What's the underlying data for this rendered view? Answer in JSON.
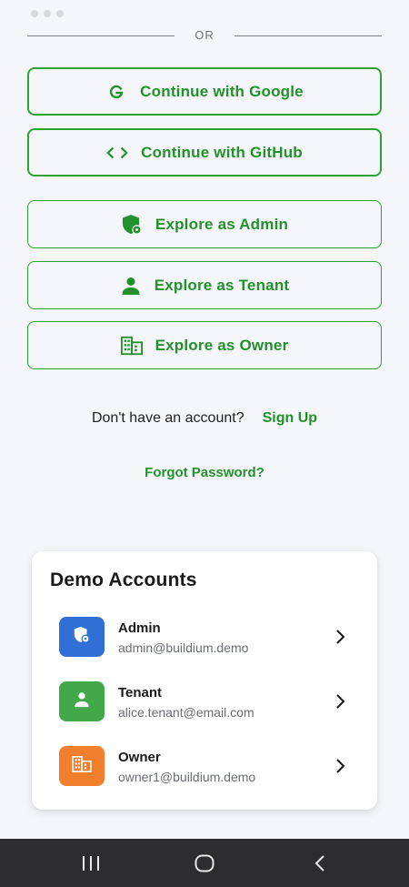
{
  "divider": {
    "or_label": "OR"
  },
  "buttons": {
    "google": {
      "label": "Continue with Google",
      "icon": "google-g-icon"
    },
    "github": {
      "label": "Continue with GitHub",
      "icon": "code-icon"
    },
    "admin": {
      "label": "Explore as Admin",
      "icon": "shield-icon"
    },
    "tenant": {
      "label": "Explore as Tenant",
      "icon": "person-icon"
    },
    "owner": {
      "label": "Explore as Owner",
      "icon": "building-icon"
    }
  },
  "signup": {
    "question": "Don't have an account?",
    "link": "Sign Up"
  },
  "forgot": {
    "label": "Forgot Password?"
  },
  "demo": {
    "title": "Demo Accounts",
    "accounts": [
      {
        "name": "Admin",
        "email": "admin@buildium.demo",
        "icon": "shield-icon",
        "color": "#2f6fd6"
      },
      {
        "name": "Tenant",
        "email": "alice.tenant@email.com",
        "icon": "person-icon",
        "color": "#43a84a"
      },
      {
        "name": "Owner",
        "email": "owner1@buildium.demo",
        "icon": "building-icon",
        "color": "#f27f2b"
      }
    ]
  },
  "colors": {
    "accent": "#23912b",
    "background": "#f4f6f9",
    "navbar": "#2d2d2f"
  },
  "navbar": {
    "icons": [
      "recent-apps-icon",
      "home-icon",
      "back-icon"
    ]
  }
}
